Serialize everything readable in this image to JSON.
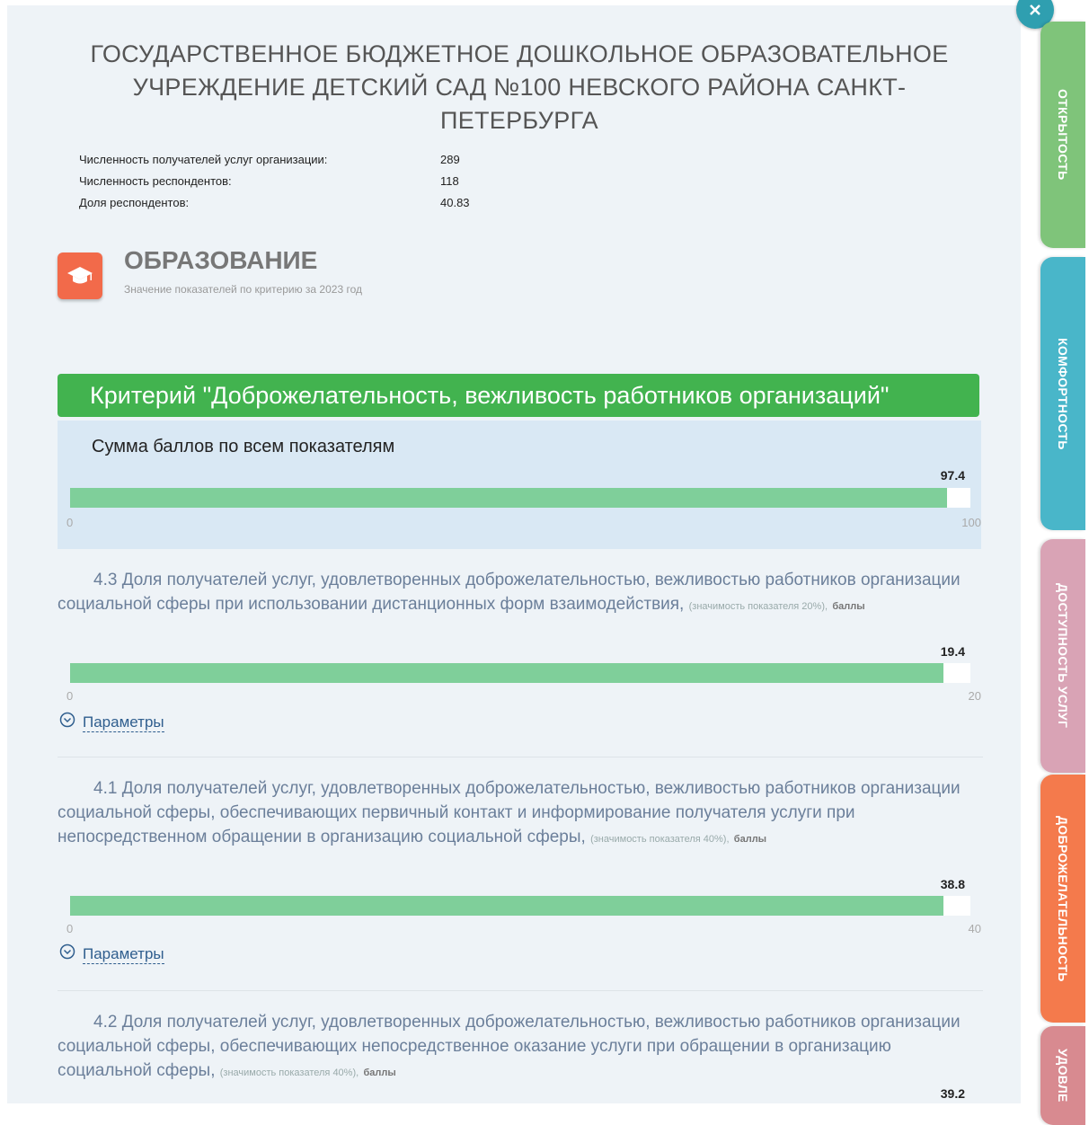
{
  "organization": {
    "title": "ГОСУДАРСТВЕННОЕ БЮДЖЕТНОЕ ДОШКОЛЬНОЕ ОБРАЗОВАТЕЛЬНОЕ УЧРЕЖДЕНИЕ ДЕТСКИЙ САД №100 НЕВСКОГО РАЙОНА САНКТ-ПЕТЕРБУРГА"
  },
  "stats": [
    {
      "label": "Численность получателей услуг организации:",
      "value": "289"
    },
    {
      "label": "Численность респондентов:",
      "value": "118"
    },
    {
      "label": "Доля респондентов:",
      "value": "40.83"
    }
  ],
  "category": {
    "icon": "graduation-cap-icon",
    "title": "ОБРАЗОВАНИЕ",
    "subtitle": "Значение показателей по критерию за 2023 год"
  },
  "criterion": {
    "title": "Критерий \"Доброжелательность, вежливость работников организаций\"",
    "sum_label": "Сумма баллов по всем показателям",
    "sum_bar": {
      "value": 97.4,
      "value_text": "97.4",
      "min": "0",
      "max": "100"
    }
  },
  "indicators": [
    {
      "text": "4.3 Доля получателей услуг, удовлетворенных доброжелательностью, вежливостью работников организации социальной сферы при использовании дистанционных форм взаимодействия,",
      "note": "(значимость показателя 20%),",
      "unit": "баллы",
      "bar": {
        "value": 19.4,
        "value_text": "19.4",
        "min": "0",
        "max": "20"
      },
      "params_label": "Параметры"
    },
    {
      "text": "4.1 Доля получателей услуг, удовлетворенных доброжелательностью, вежливостью работников организации социальной сферы, обеспечивающих первичный контакт и информирование получателя услуги при непосредственном обращении в организацию социальной сферы,",
      "note": "(значимость показателя 40%),",
      "unit": "баллы",
      "bar": {
        "value": 38.8,
        "value_text": "38.8",
        "min": "0",
        "max": "40"
      },
      "params_label": "Параметры"
    },
    {
      "text": "4.2 Доля получателей услуг, удовлетворенных доброжелательностью, вежливостью работников организации социальной сферы, обеспечивающих непосредственное оказание услуги при обращении в организацию социальной сферы,",
      "note": "(значимость показателя 40%),",
      "unit": "баллы",
      "bar": {
        "value": 39.2,
        "value_text": "39.2",
        "min": "0",
        "max": "40"
      }
    }
  ],
  "side_tabs": [
    {
      "label": "ОТКРЫТОСТЬ",
      "color": "#7fc47a"
    },
    {
      "label": "КОМФОРТНОСТЬ",
      "color": "#49b6c9"
    },
    {
      "label": "ДОСТУПНОСТЬ УСЛУГ",
      "color": "#d9a3b5"
    },
    {
      "label": "ДОБРОЖЕЛАТЕЛЬНОСТЬ",
      "color": "#f47a4c"
    },
    {
      "label": "УДОВЛЕ",
      "color": "#d88a90"
    }
  ],
  "colors": {
    "header_green": "#42b34f",
    "bar_fill": "#7fcf9a",
    "icon_orange": "#f26a4a",
    "link_blue": "#2f5e8e"
  }
}
